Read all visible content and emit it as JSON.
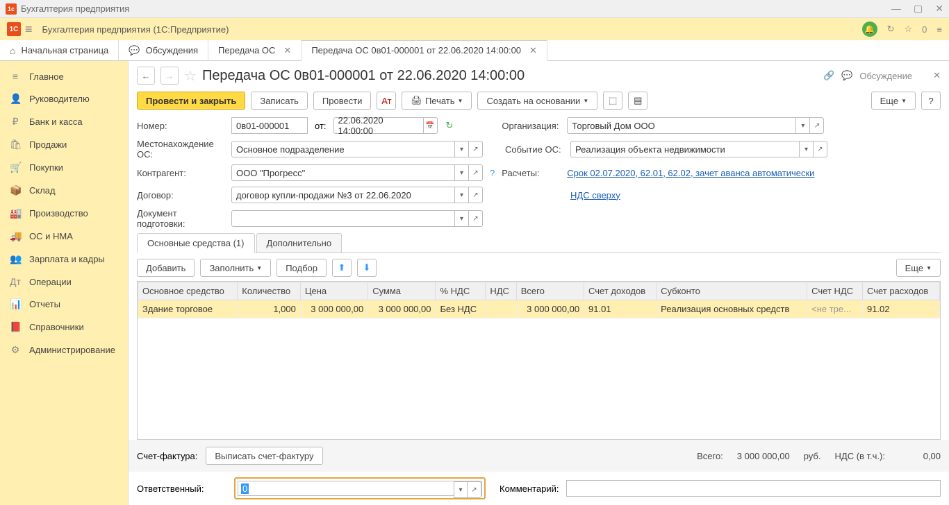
{
  "titlebar": {
    "text": "Бухгалтерия предприятия"
  },
  "topbar": {
    "title": "Бухгалтерия предприятия  (1С:Предприятие)",
    "zero": "0"
  },
  "tabs": {
    "home": "Начальная страница",
    "discuss": "Обсуждения",
    "t1": "Передача ОС",
    "t2": "Передача ОС 0в01-000001 от 22.06.2020 14:00:00"
  },
  "sidebar": {
    "items": [
      {
        "icon": "≡",
        "label": "Главное"
      },
      {
        "icon": "👤",
        "label": "Руководителю"
      },
      {
        "icon": "₽",
        "label": "Банк и касса"
      },
      {
        "icon": "🛍",
        "label": "Продажи"
      },
      {
        "icon": "🛒",
        "label": "Покупки"
      },
      {
        "icon": "📦",
        "label": "Склад"
      },
      {
        "icon": "🏭",
        "label": "Производство"
      },
      {
        "icon": "🚚",
        "label": "ОС и НМА"
      },
      {
        "icon": "👥",
        "label": "Зарплата и кадры"
      },
      {
        "icon": "Дт",
        "label": "Операции"
      },
      {
        "icon": "📊",
        "label": "Отчеты"
      },
      {
        "icon": "📕",
        "label": "Справочники"
      },
      {
        "icon": "⚙",
        "label": "Администрирование"
      }
    ]
  },
  "doc": {
    "title": "Передача ОС 0в01-000001 от 22.06.2020 14:00:00",
    "discuss_btn": "Обсуждение"
  },
  "toolbar": {
    "post_close": "Провести и закрыть",
    "save": "Записать",
    "post": "Провести",
    "print": "Печать",
    "create_based": "Создать на основании",
    "more": "Еще"
  },
  "form": {
    "number_label": "Номер:",
    "number": "0в01-000001",
    "from_label": "от:",
    "date": "22.06.2020 14:00:00",
    "org_label": "Организация:",
    "org": "Торговый Дом ООО",
    "loc_label": "Местонахождение ОС:",
    "loc": "Основное подразделение",
    "event_label": "Событие ОС:",
    "event": "Реализация объекта недвижимости",
    "counter_label": "Контрагент:",
    "counter": "ООО \"Прогресс\"",
    "calc_label": "Расчеты:",
    "calc_link": "Срок 02.07.2020, 62.01, 62.02, зачет аванса автоматически",
    "contract_label": "Договор:",
    "contract": "договор купли-продажи №3 от 22.06.2020",
    "vat_link": "НДС сверху",
    "prep_label": "Документ подготовки:"
  },
  "tabs2": {
    "t1": "Основные средства (1)",
    "t2": "Дополнительно"
  },
  "tbl_toolbar": {
    "add": "Добавить",
    "fill": "Заполнить",
    "select": "Подбор",
    "more": "Еще"
  },
  "table": {
    "h": [
      "Основное средство",
      "Количество",
      "Цена",
      "Сумма",
      "% НДС",
      "НДС",
      "Всего",
      "Счет доходов",
      "Субконто",
      "Счет НДС",
      "Счет расходов"
    ],
    "row": {
      "name": "Здание торговое",
      "qty": "1,000",
      "price": "3 000 000,00",
      "sum": "3 000 000,00",
      "vat_rate": "Без НДС",
      "vat": "",
      "total": "3 000 000,00",
      "inc_acc": "91.01",
      "subk": "Реализация основных средств",
      "vat_acc": "<не тре...",
      "exp_acc": "91.02"
    }
  },
  "footer": {
    "invoice_label": "Счет-фактура:",
    "invoice_btn": "Выписать счет-фактуру",
    "total_label": "Всего:",
    "total": "3 000 000,00",
    "curr": "руб.",
    "vat_label": "НДС (в т.ч.):",
    "vat": "0,00",
    "resp_label": "Ответственный:",
    "resp_val": "0",
    "comment_label": "Комментарий:"
  }
}
